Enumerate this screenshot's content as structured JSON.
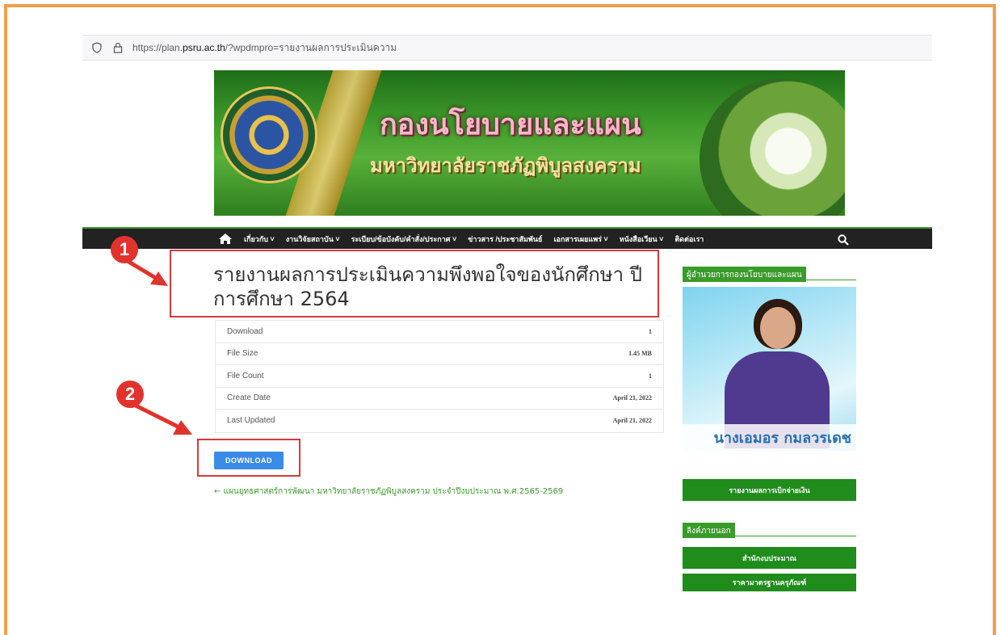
{
  "browser": {
    "url_prefix": "https://plan.",
    "url_domain": "psru.ac.th",
    "url_path": "/?wpdmpro=รายงานผลการประเมินความ"
  },
  "banner": {
    "title": "กองนโยบายและแผน",
    "subtitle": "มหาวิทยาลัยราชภัฏพิบูลสงคราม"
  },
  "nav": {
    "items": [
      "เกี่ยวกับ ˅",
      "งานวิจัยสถาบัน ˅",
      "ระเบียบ/ข้อบังคับ/คำสั่ง/ประกาศ ˅",
      "ข่าวสาร /ประชาสัมพันธ์",
      "เอกสารเผยแพร่ ˅",
      "หนังสือเวียน ˅",
      "ติดต่อเรา"
    ]
  },
  "page": {
    "title": "รายงานผลการประเมินความพึงพอใจของนักศึกษา ปีการศึกษา 2564",
    "download_button": "DOWNLOAD",
    "prev_link": "← แผนยุทธศาสตร์การพัฒนา มหาวิทยาลัยราชภัฏพิบูลสงคราม ประจำปีงบประมาณ พ.ศ.2565-2569"
  },
  "info_table": [
    {
      "label": "Download",
      "value": "1"
    },
    {
      "label": "File Size",
      "value": "1.45 MB"
    },
    {
      "label": "File Count",
      "value": "1"
    },
    {
      "label": "Create Date",
      "value": "April 21, 2022"
    },
    {
      "label": "Last Updated",
      "value": "April 21, 2022"
    }
  ],
  "markers": {
    "step1": "1",
    "step2": "2"
  },
  "sidebar": {
    "director_heading": "ผู้อำนวยการกองนโยบายและแผน",
    "director_name": "นางเอมอร กมลวรเดช",
    "report_button": "รายงานผลการเบิกจ่ายเงิน",
    "links_heading": "ลิงค์ภายนอก",
    "link1": "สำนักงบประมาณ",
    "link2": "ราคามาตรฐานครุภัณฑ์"
  },
  "colors": {
    "accent_green": "#3a9b2b",
    "marker_red": "#e2322d",
    "button_blue": "#3a8be6",
    "frame_orange": "#f0a04b"
  }
}
